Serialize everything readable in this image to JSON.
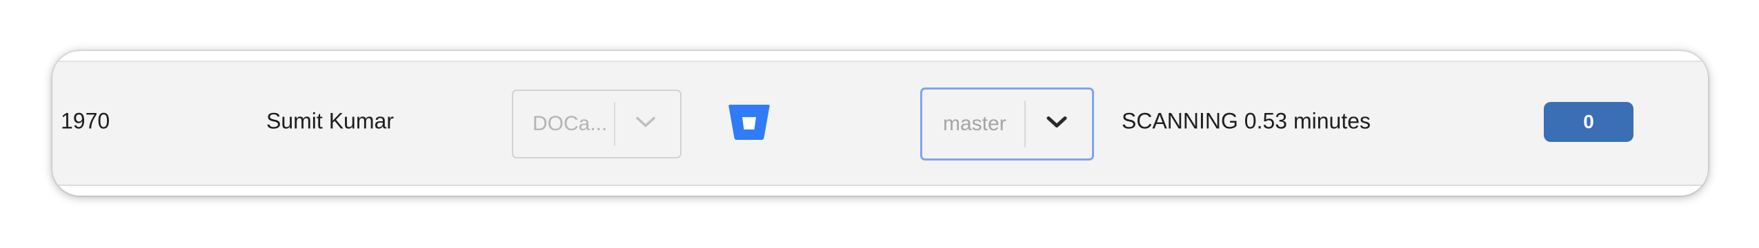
{
  "row": {
    "id": "1970",
    "owner": "Sumit Kumar",
    "repo_select": {
      "value": "DOCa..."
    },
    "provider_icon": "bitbucket-icon",
    "branch_select": {
      "value": "master"
    },
    "status": "SCANNING 0.53 minutes",
    "count_badge": "0"
  },
  "colors": {
    "bitbucket_blue": "#2f7cf6",
    "badge_blue": "#3a6eb5",
    "focus_border": "#7fa5e8"
  }
}
